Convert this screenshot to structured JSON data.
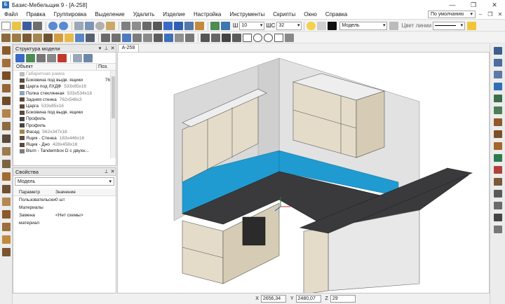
{
  "window": {
    "title": "Базис-Мебельщик 9 - [А-258]",
    "controls": [
      "—",
      "❐",
      "✕"
    ]
  },
  "menu": {
    "items": [
      "Файл",
      "Правка",
      "Группировка",
      "Выделение",
      "Удалить",
      "Изделие",
      "Настройка",
      "Инструменты",
      "Скрипты",
      "Окно",
      "Справка"
    ],
    "preset": "По умолчанию"
  },
  "toolbar": {
    "w_label": "Ш",
    "w_value": "10",
    "shs_label": "ШС",
    "shs_value": "32",
    "layer": "Модель",
    "line_color_label": "Цвет линии"
  },
  "structure_panel": {
    "title": "Структура модели",
    "col_object": "Объект",
    "col_pos": "Поз.",
    "rows": [
      {
        "name": "Габаритная рамка",
        "dim": "",
        "pos": ""
      },
      {
        "name": "Боковина под выдв. ящики",
        "dim": "",
        "pos": "76"
      },
      {
        "name": "Царга под ЛХДФ",
        "dim": "533x85x16",
        "pos": ""
      },
      {
        "name": "Полка стеклянная",
        "dim": "533x534x16",
        "pos": ""
      },
      {
        "name": "Задняя стенка",
        "dim": "762x548x3",
        "pos": ""
      },
      {
        "name": "Царга",
        "dim": "533x85x16",
        "pos": ""
      },
      {
        "name": "Боковина под выдв. ящики",
        "dim": "",
        "pos": ""
      },
      {
        "name": "Профиль",
        "dim": "",
        "pos": ""
      },
      {
        "name": "Профиль",
        "dim": "",
        "pos": ""
      },
      {
        "name": "Фасад",
        "dim": "562x347x18",
        "pos": ""
      },
      {
        "name": "Ящик - Стенка",
        "dim": "183x446x16",
        "pos": ""
      },
      {
        "name": "Ящик - Дно",
        "dim": "428x458x16",
        "pos": ""
      },
      {
        "name": "Blum - Tandembox D с двухн...",
        "dim": "",
        "pos": ""
      }
    ]
  },
  "properties_panel": {
    "title": "Свойства",
    "selected": "Модель",
    "col_param": "Параметр",
    "col_value": "Значение",
    "rows": [
      {
        "k": "Пользовательски",
        "v": "0 шт"
      },
      {
        "k": "Материалы",
        "v": ""
      },
      {
        "k": "Замена материал",
        "v": "<Нет схемы>"
      }
    ]
  },
  "document_tab": "А-258",
  "status": {
    "x_label": "X",
    "x_value": "2656,34",
    "y_label": "Y",
    "y_value": "2480,07",
    "z_label": "Z",
    "z_value": "29"
  },
  "colors": {
    "backsplash": "#1f9bd1",
    "countertop": "#3a3a3d",
    "cabinet": "#e4dcc9",
    "cabinet_side": "#d6ccb5",
    "wall": "#d7d7d7"
  }
}
